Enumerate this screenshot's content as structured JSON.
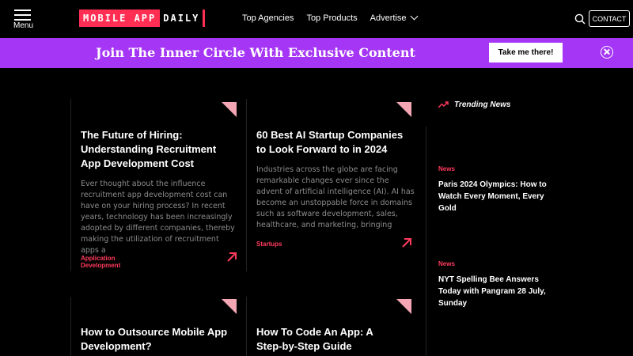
{
  "header": {
    "menu_label": "Menu",
    "logo_primary": "MOBILE APP",
    "logo_secondary": "DAILY",
    "nav": [
      {
        "label": "Top Agencies"
      },
      {
        "label": "Top Products"
      },
      {
        "label": "Advertise"
      }
    ],
    "contact_label": "CONTACT",
    "icons": {
      "search": "search-icon",
      "menu": "hamburger-icon"
    }
  },
  "banner": {
    "text": "Join The Inner Circle With Exclusive Content",
    "button": "Take me there!",
    "close_icon": "close-circle-icon",
    "color": "#a536f5"
  },
  "cards": [
    {
      "title": "The Future of Hiring: Understanding Recruitment App Development Cost",
      "excerpt": "Ever thought about the influence recruitment app development cost can have on your hiring process? In recent years, technology has been increasingly adopted by different companies, thereby making the utilization of recruitment apps a",
      "category": "Application Development"
    },
    {
      "title": "60 Best AI Startup Companies to Look Forward to in 2024",
      "excerpt": "Industries across the globe are facing remarkable changes ever since the advent of artificial intelligence (AI). AI has become an unstoppable force in domains such as software development, sales, healthcare, and marketing, bringing",
      "category": "Startups"
    },
    {
      "title": "How to Outsource Mobile App Development?",
      "excerpt": "",
      "category": ""
    },
    {
      "title": "How To Code An App: A Step-by-Step Guide",
      "excerpt": "",
      "category": ""
    }
  ],
  "trending": {
    "title": "Trending News",
    "items": [
      {
        "category": "News",
        "title": "Paris 2024 Olympics: How to Watch Every Moment, Every Gold"
      },
      {
        "category": "News",
        "title": "NYT Spelling Bee Answers Today with Pangram 28 July, Sunday"
      }
    ]
  },
  "colors": {
    "accent": "#ff3b5c",
    "corner": "#f4a6b4",
    "background": "#000000"
  }
}
